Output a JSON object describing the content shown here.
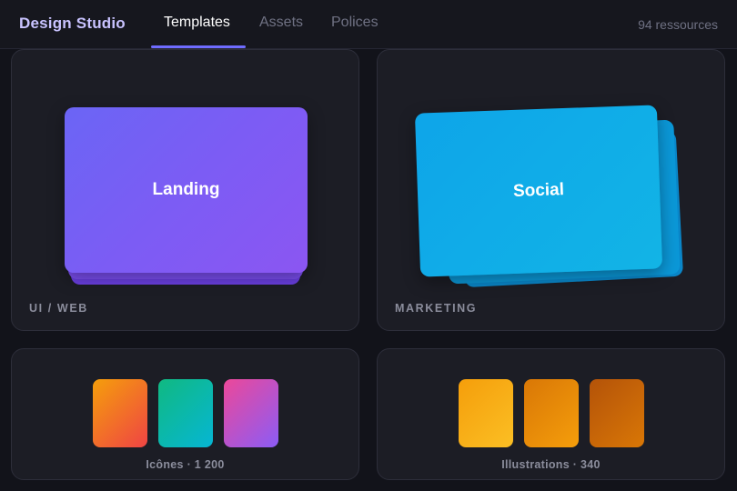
{
  "header": {
    "brand": "Design Studio",
    "tabs": [
      {
        "label": "Templates",
        "active": true
      },
      {
        "label": "Assets",
        "active": false
      },
      {
        "label": "Polices",
        "active": false
      }
    ],
    "resource_count": "94 ressources",
    "accent_color": "#6f6cff"
  },
  "cards": {
    "ui_web": {
      "preview_title": "Landing",
      "category": "UI / WEB",
      "color": "#7c5cf4"
    },
    "marketing": {
      "preview_title": "Social",
      "category": "MARKETING",
      "color": "#0ea5e9"
    },
    "icons": {
      "label": "Icônes · 1 200",
      "swatches": [
        "#f97316",
        "#10b981",
        "#ec4899"
      ]
    },
    "illustrations": {
      "label": "Illustrations · 340",
      "swatches": [
        "#fbbf24",
        "#f59e0b",
        "#d97706"
      ]
    }
  }
}
